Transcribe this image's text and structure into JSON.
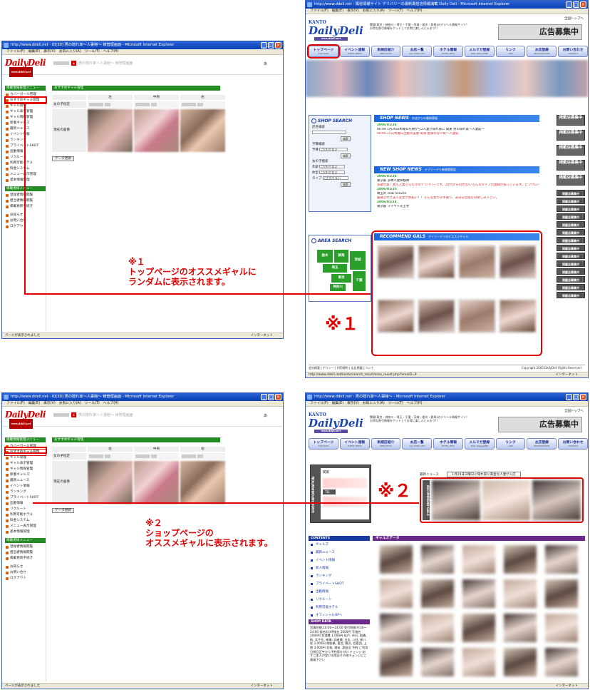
{
  "colors": {
    "accent": "#e00000",
    "admin_green": "#228b22",
    "site_blue": "#1a66dd",
    "purple": "#6a2a8a"
  },
  "admin_top": {
    "title": "http://www.ddeli.net - ID[30] 男の隠れ家〜人妻館〜 様管理画面 - Microsoft Internet Explorer",
    "menu": [
      "ファイル(F)",
      "編集(E)",
      "表示(V)",
      "お気に入り(A)",
      "ツール(T)",
      "ヘルプ(H)"
    ],
    "logo": "DailyDeli",
    "logo_sub": "www.ddeli.net",
    "mgmt_label": "男の隠れ家〜人妻館〜 様管理画面",
    "close_mark": "あ",
    "section_title": "おすすめギャル管理",
    "cols": [
      "左",
      "中央",
      "右"
    ],
    "row_labels": [
      "女の子指定",
      "現在の画像"
    ],
    "update_button": "データ更新",
    "status": "ページが表示されました",
    "net": "インターネット"
  },
  "admin_bottom": {
    "title": "http://www.ddeli.net - ID[30] 男の隠れ家〜人妻館〜 様管理画面 - Microsoft Internet Explorer",
    "section_title": "おすすめギャル管理"
  },
  "sidebar": {
    "groups": [
      {
        "head": "掲載情報管理メニュー",
        "items": [
          "カバーガール管理",
          "おすすめギャル管理",
          "ギャル管理",
          "ギャル表示管理",
          "ギャル情報管理",
          "新着ギャルズ",
          "最新ニュース",
          "イベント情報",
          "ランキング",
          "プライベートSHOT",
          "出勤情報",
          "リクルート",
          "利用可能ホテル",
          "料金システム",
          "メニュー表示管理",
          "基本情報管理"
        ]
      },
      {
        "head": "掲載者様メニュー",
        "items": [
          "登録者情報閲覧",
          "担当者情報閲覧",
          "掲載更新手続き"
        ]
      },
      {
        "head": "",
        "items": [
          "お知らせ",
          "お問い合せ",
          "ログアウト"
        ]
      }
    ]
  },
  "site_top": {
    "title": "http://www.ddeli.net - 風俗情報サイト デリバリーの最新風俗店情報満載 Daily Deli - Microsoft Internet Explorer",
    "kanto": "KANTO",
    "logo": "DailyDeli",
    "logo_url": "www.ddeli.net",
    "blurb": "関東(東京・神奈川・埼玉・千葉・茨城・栃木・群馬)のデリヘル情報サイト! お得な割引情報をゲットしてお得に楽しんじゃおう!!",
    "ad": "広告募集中",
    "nav": [
      {
        "label": "トップページ",
        "sub": "TOP PAGE"
      },
      {
        "label": "イベント速報",
        "sub": "EVENT NEWS"
      },
      {
        "label": "新規店紹介",
        "sub": "NEW SHOP"
      },
      {
        "label": "お店一覧",
        "sub": "ALL SHOP LIST"
      },
      {
        "label": "ホテル情報",
        "sub": "HOTEL INFO"
      },
      {
        "label": "メルマガ登録",
        "sub": "MAIL MAGAZINE"
      },
      {
        "label": "リンク",
        "sub": "LINK"
      },
      {
        "label": "お店登録",
        "sub": "REGISTRATION"
      },
      {
        "label": "お問い合わせ",
        "sub": "CONTACT"
      }
    ],
    "shop_search": "SHOP SEARCH",
    "search_labels": [
      "店名検索",
      "予算検索",
      "女の子検索"
    ],
    "search_btn": "検索",
    "filter_labels": [
      "予算",
      "年齢",
      "体型",
      "タイプ"
    ],
    "filter_value": "こだわりない",
    "area_search": "AREA SEARCH",
    "prefs": [
      "栃木",
      "群馬",
      "茨城",
      "埼玉",
      "東京",
      "千葉",
      "神奈川"
    ],
    "shop_news_head": "SHOP NEWS",
    "shop_news_sub": "お店からの最新情報",
    "shop_news": [
      {
        "date": "2006/01/26"
      },
      {
        "text": "00:09 1月26日木曜日も朝から2人妻が隠れ家に 関東 男の隠れ家〜人妻館〜"
      },
      {
        "text": "00:05 25日木曜日出勤の美妻 関東 姫様のない妃〜人妻館"
      }
    ],
    "new_shop_head": "NEW SHOP NEWS",
    "new_shop_sub": "デイリーデリ新規登録店",
    "new_shop": [
      {
        "date": "2006/01/26"
      },
      {
        "text": "東京都 多摩人妻探検隊"
      },
      {
        "text": "多摩市発！素人人妻さんだけのデリバリーです。20代から40代のいろんなタイプの奥様が揃っています。ピンクローター、コスプレも無料です！"
      },
      {
        "date": "2006/01/25"
      },
      {
        "text": "埼玉県 club heaven"
      },
      {
        "text": "厳選された美人美女が勢揃い！！そんな女の子手選り、非日常空間をお楽しみ下さい。"
      },
      {
        "date": "2006/01/24"
      },
      {
        "text": "東京都 マイヤト天王寺"
      }
    ],
    "recommend_head": "RECOMMEND GALS",
    "recommend_sub": "デイリーデリのオススメギャル",
    "kb_big": [
      "掲載店募集中",
      "掲載店募集中",
      "掲載店募集中",
      "掲載店募集中",
      "掲載店募集中"
    ],
    "kb_small": "掲載店募集中",
    "footer": "会社概要 | ポリシー | 利用規約 | 広告掲載について",
    "copyright": "Copyright 2005 DailyDeli Rights Reserved.",
    "status": "http://www.ddeli.net/kanto/search_result/area_result.php?areaID=9",
    "to_top": "全国トップへ"
  },
  "site_bottom": {
    "title": "http://www.ddeli.net - 男の隠れ家〜人妻館〜 - Microsoft Internet Explorer",
    "shop_info_label": "SHOP INFORMATION",
    "area_label": "関東",
    "news_label": "最新ニュース",
    "news_text": "1月29日日曜日に隠れ家に黄金な人妻が入店",
    "tel_label": "TEL",
    "recommend_label": "RECOMMEND GALS",
    "contents_head": "CONTENTS",
    "contents": [
      "ギャルズ",
      "最新ニュース",
      "イベント情報",
      "新人情報",
      "ランキング",
      "プライベートSHOT",
      "出勤情報",
      "リクルート",
      "利用可能ホテル",
      "オフィシャルHPへ"
    ],
    "shop_data_head": "SHOP DATA",
    "shop_data": "営業時間:10:00〜24:00 受付時間:9:30〜24:00 指名料:HP指名 1000円 写指名 2000円 交通費:1,000円 松戸, 市川, 船橋, 柏, 北千住, 綾瀬, 北綾瀬, 五反, 八柱, 新八柱 2,000円 南船橋, 葛西, 舞浜, 西葛西, 上野 3,000円 北柏, 浦安, 津田沼 予約:ご利用日前日正午から予約受け付け チェンジ:必ずご本人が受ける際はその他チェンジにご連絡下さい",
    "gals_head": "ギャルズデータ"
  },
  "annotations": {
    "note1_mark": "※１",
    "note1_line1": "トップページのオススメギャルに",
    "note1_line2": "ランダムに表示されます。",
    "big1": "※１",
    "note2_mark": "※２",
    "note2_line1": "ショップページの",
    "note2_line2": "オススメギャルに表示されます。",
    "big2": "※２"
  }
}
